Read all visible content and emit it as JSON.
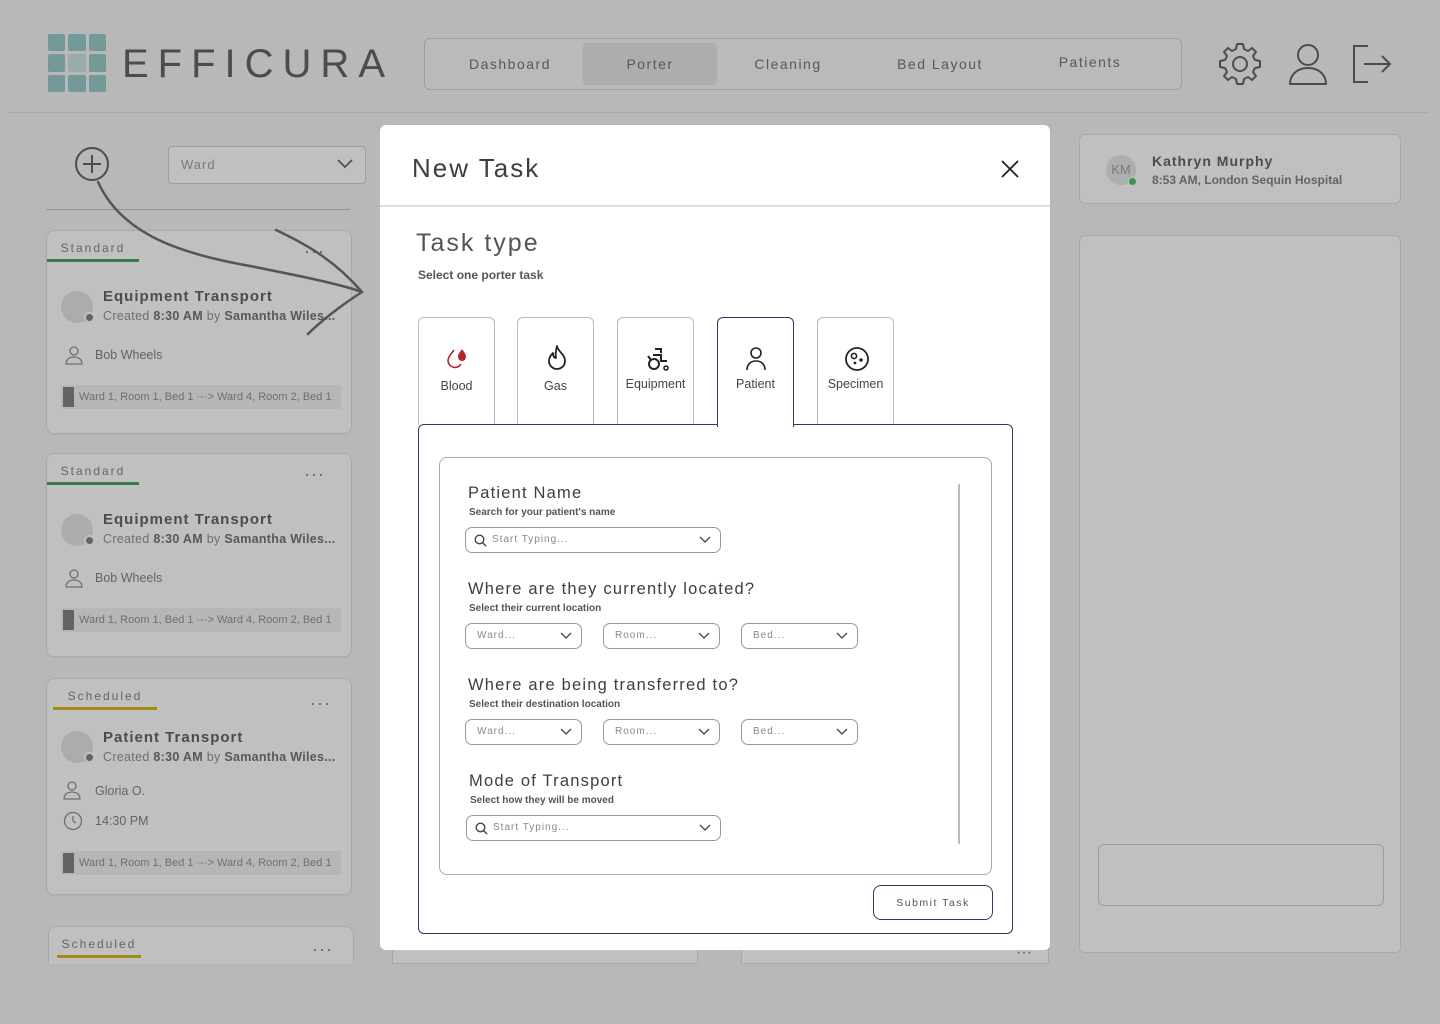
{
  "app": {
    "logo_text": "EFFICURA"
  },
  "nav": {
    "items": [
      "Dashboard",
      "Porter",
      "Cleaning",
      "Bed Layout",
      "Patients"
    ],
    "active": "Porter"
  },
  "toolbar": {
    "ward_placeholder": "Ward"
  },
  "user": {
    "initials": "KM",
    "name": "Kathryn Murphy",
    "meta": "8:53 AM, London Sequin Hospital",
    "status_color": "#38c25a"
  },
  "tasks": [
    {
      "tag": "Standard",
      "tag_color": "#3a9a4a",
      "title": "Equipment Transport",
      "created_prefix": "Created",
      "time": "8:30 AM",
      "by": "by",
      "creator": "Samantha Wiles...",
      "assignee": "Bob Wheels",
      "route": "Ward 1, Room 1, Bed 1  ·-·> Ward 4, Room 2, Bed 1"
    },
    {
      "tag": "Standard",
      "tag_color": "#3a9a4a",
      "title": "Equipment Transport",
      "created_prefix": "Created",
      "time": "8:30 AM",
      "by": "by",
      "creator": "Samantha Wiles...",
      "assignee": "Bob Wheels",
      "route": "Ward 1, Room 1, Bed 1  ·-·> Ward 4, Room 2, Bed 1"
    },
    {
      "tag": "Scheduled",
      "tag_color": "#d9b100",
      "title": "Patient Transport",
      "created_prefix": "Created",
      "time": "8:30 AM",
      "by": "by",
      "creator": "Samantha Wiles...",
      "assignee": "Gloria O.",
      "scheduled_time": "14:30 PM",
      "route": "Ward 1, Room 1, Bed 1  ·-·> Ward 4, Room 2, Bed 1"
    },
    {
      "tag": "Scheduled",
      "tag_color": "#d9b100"
    }
  ],
  "modal": {
    "title": "New Task",
    "section_title": "Task type",
    "section_sub": "Select one porter task",
    "task_types": [
      {
        "label": "Blood",
        "icon": "blood-drop-icon"
      },
      {
        "label": "Gas",
        "icon": "flame-icon"
      },
      {
        "label": "Equipment",
        "icon": "wheelchair-icon"
      },
      {
        "label": "Patient",
        "icon": "person-icon"
      },
      {
        "label": "Specimen",
        "icon": "specimen-icon"
      }
    ],
    "selected_type": "Patient",
    "patient_name": {
      "label": "Patient Name",
      "sub": "Search for your patient's name",
      "placeholder": "Start Typing..."
    },
    "current_location": {
      "label": "Where are they currently located?",
      "sub": "Select their current location",
      "ward": "Ward...",
      "room": "Room...",
      "bed": "Bed..."
    },
    "destination": {
      "label": "Where are being transferred to?",
      "sub": "Select their destination location",
      "ward": "Ward...",
      "room": "Room...",
      "bed": "Bed..."
    },
    "transport": {
      "label": "Mode of Transport",
      "sub": "Select how they will be moved",
      "placeholder": "Start Typing..."
    },
    "submit_label": "Submit Task"
  },
  "colors": {
    "accent": "#2c3a66",
    "blood": "#b3262b",
    "teal": "#3aa3a0"
  }
}
